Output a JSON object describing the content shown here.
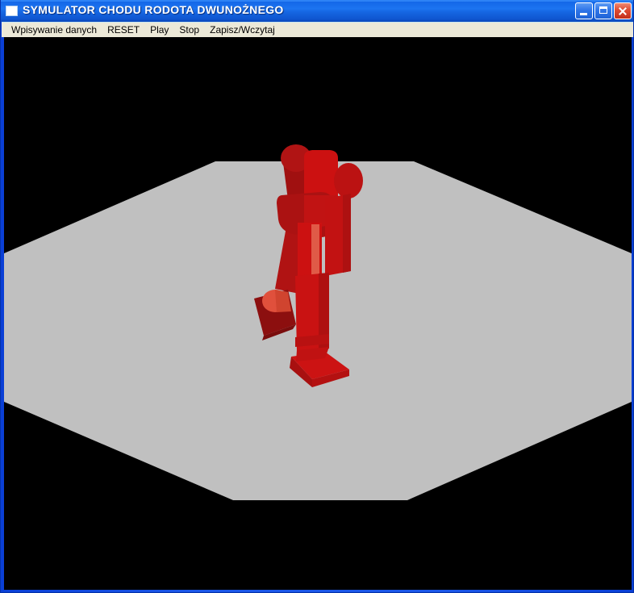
{
  "window": {
    "title": "SYMULATOR CHODU RODOTA DWUNOŻNEGO",
    "icon": "application-window-icon",
    "controls": [
      {
        "name": "minimize-button",
        "label": "Minimize"
      },
      {
        "name": "maximize-button",
        "label": "Maximize"
      },
      {
        "name": "close-button",
        "label": "Close"
      }
    ]
  },
  "menubar": {
    "items": [
      {
        "label": "Wpisywanie danych"
      },
      {
        "label": "RESET"
      },
      {
        "label": "Play"
      },
      {
        "label": "Stop"
      },
      {
        "label": "Zapisz/Wczytaj"
      }
    ]
  },
  "viewport": {
    "name": "simulation-3d-viewport",
    "background_color": "#000000",
    "ground_color": "#c0c0c0",
    "robot": {
      "color_base": "#cc1111",
      "color_shadow": "#a01010",
      "color_dark": "#8c0f0f",
      "color_highlight": "#e8614f",
      "description": "Czerwony robot dwunożny stojący na szarej płaszczyźnie"
    }
  }
}
